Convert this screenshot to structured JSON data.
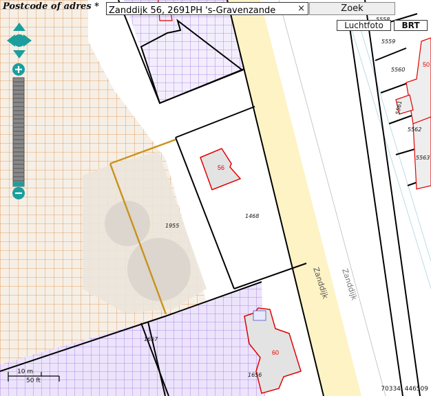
{
  "search": {
    "label": "Postcode of adres *",
    "value": "Zanddijk 56, 2691PH 's-Gravenzande",
    "clear_label": "×",
    "button_label": "Zoek"
  },
  "layers": {
    "aerial_label": "Luchtfoto",
    "brt_label": "BRT"
  },
  "map": {
    "street_name": "Zanddijk",
    "parcels": [
      "1955",
      "1468",
      "1657",
      "1656"
    ],
    "house_numbers": [
      "56",
      "60",
      "50"
    ],
    "side_parcels": [
      "5558",
      "5559",
      "5560",
      "5561",
      "5562",
      "5563"
    ],
    "coordinates": "70334, 446509"
  },
  "scale": {
    "metric": "10 m",
    "imperial": "50 ft"
  },
  "colors": {
    "road": "#fdf3c4",
    "grid_orange": "#e08a3c",
    "grid_purple": "#a070e0",
    "parcel_line": "#000000",
    "building": "#e3e3e3",
    "building_outline": "#e00000",
    "nav_control": "#1a9e9e"
  },
  "icons": [
    "pan-up-icon",
    "pan-down-icon",
    "pan-left-icon",
    "pan-right-icon",
    "zoom-in-icon",
    "zoom-out-icon",
    "clear-icon"
  ]
}
